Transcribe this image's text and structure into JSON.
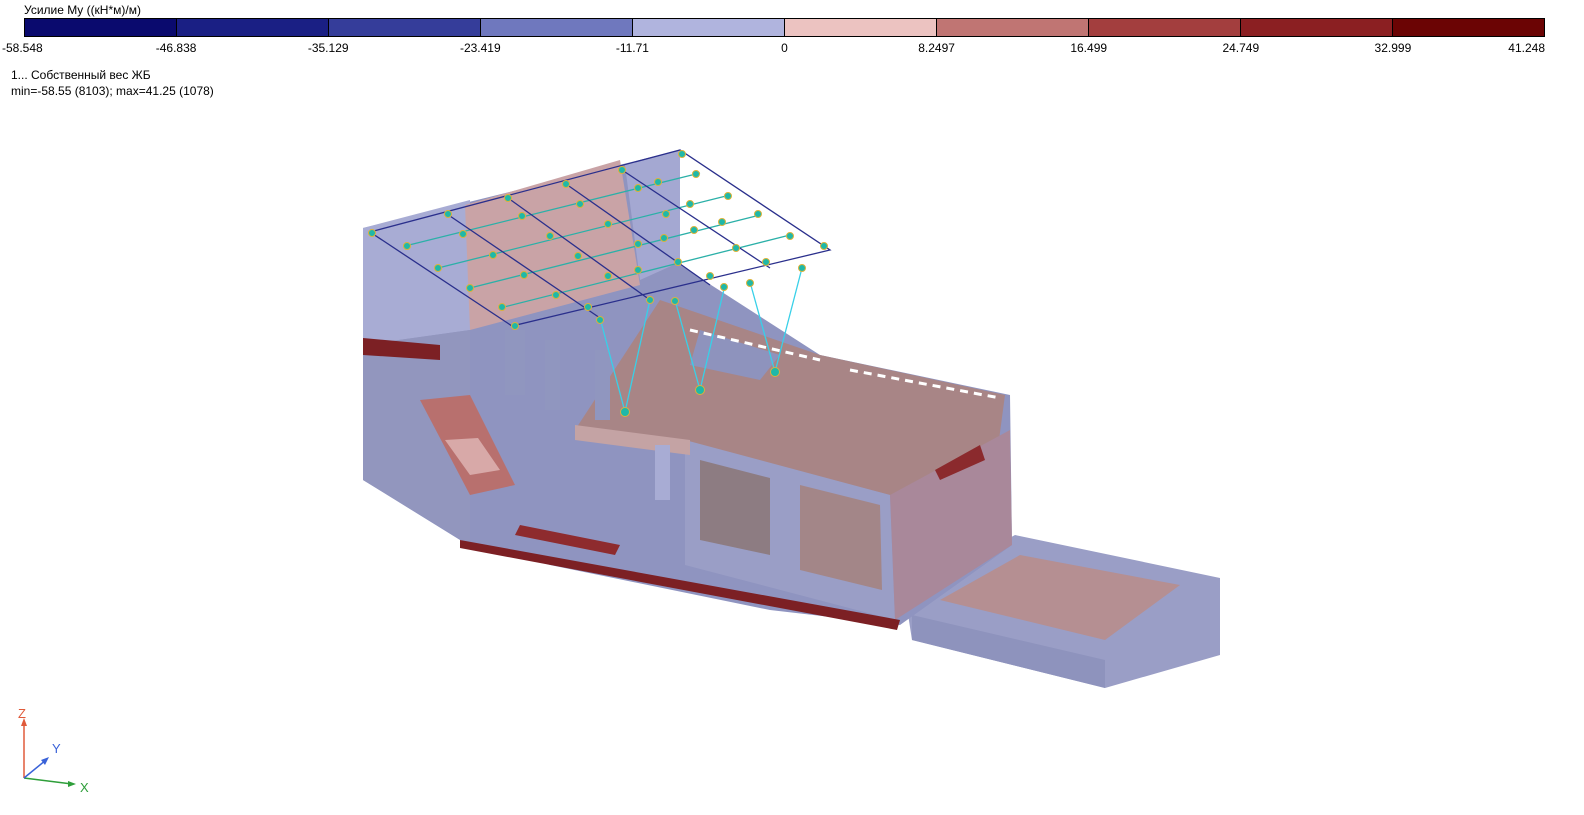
{
  "legend": {
    "title": "Усилие My ((кН*м)/м)",
    "colors": [
      "#0a0a6e",
      "#1a1f84",
      "#353d9a",
      "#6f78be",
      "#b0b4de",
      "#ecc3c1",
      "#c07573",
      "#a33e3e",
      "#8b1f22",
      "#6b0404"
    ],
    "ticks": [
      "-58.548",
      "-46.838",
      "-35.129",
      "-23.419",
      "-11.71",
      "0",
      "8.2497",
      "16.499",
      "24.749",
      "32.999",
      "41.248"
    ]
  },
  "load_case": "1... Собственный вес ЖБ",
  "minmax": "min=-58.55 (8103); max=41.25 (1078)",
  "axes": {
    "x": "X",
    "y": "Y",
    "z": "Z"
  }
}
